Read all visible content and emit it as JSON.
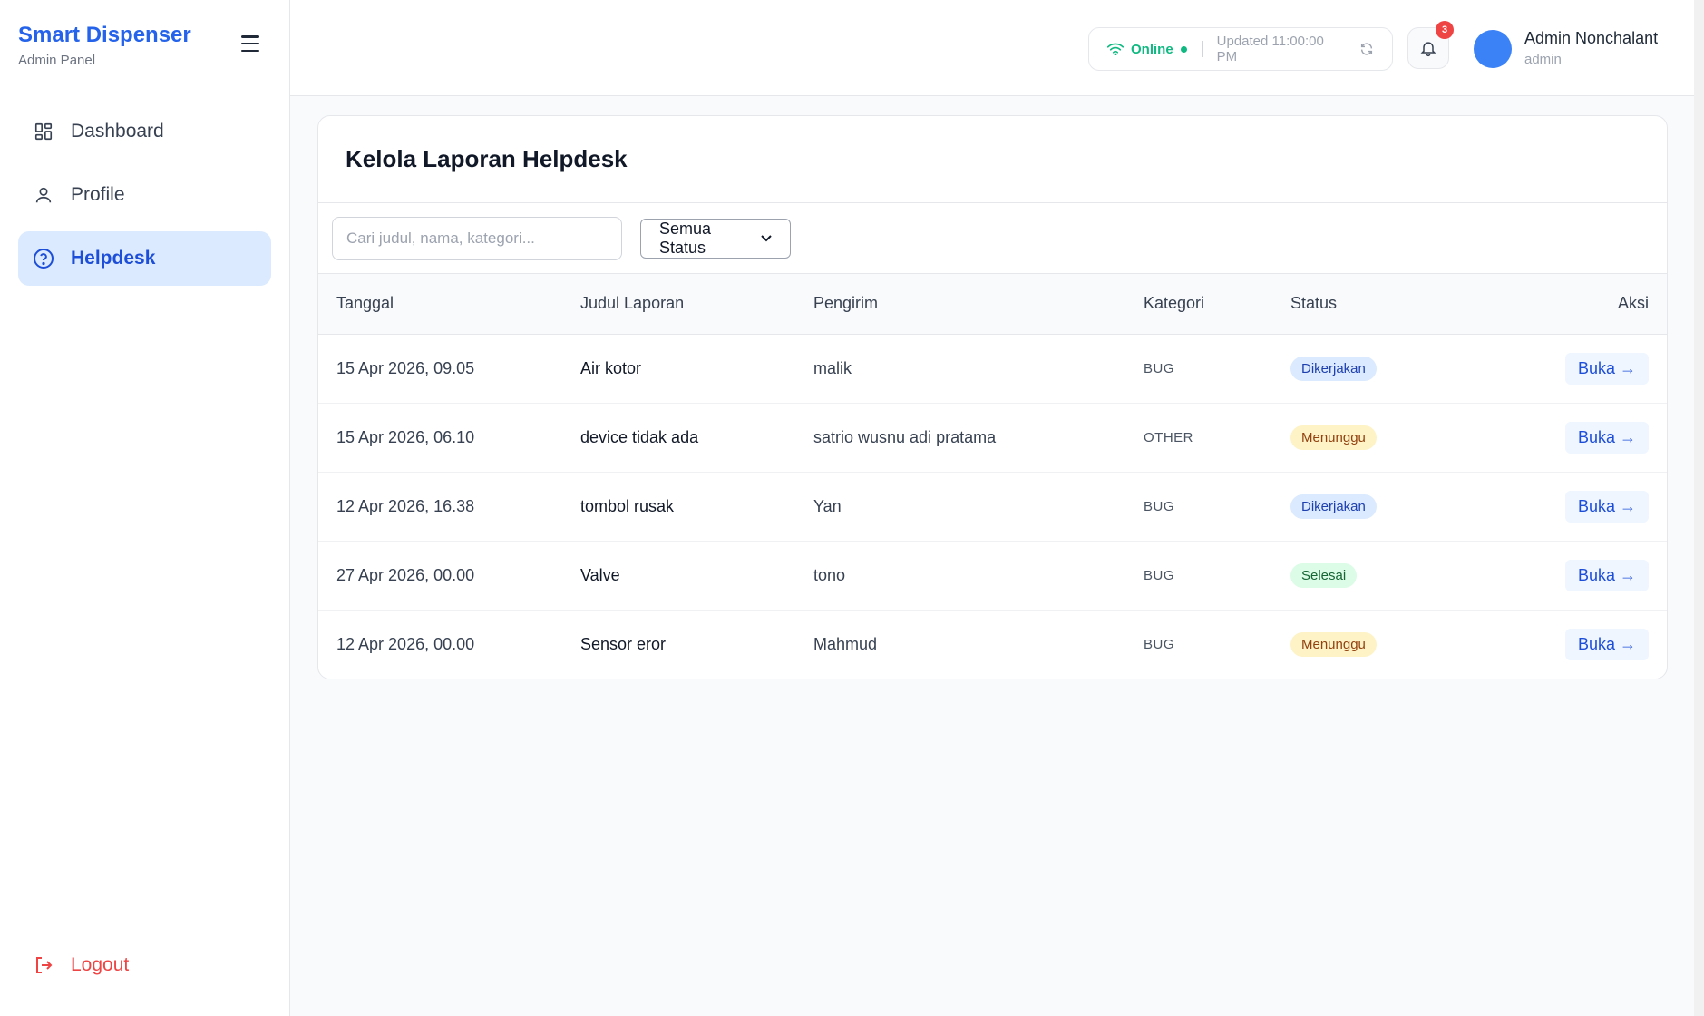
{
  "brand": {
    "title": "Smart Dispenser",
    "subtitle": "Admin Panel"
  },
  "sidebar": {
    "items": [
      {
        "label": "Dashboard",
        "icon": "grid-icon",
        "active": false
      },
      {
        "label": "Profile",
        "icon": "user-icon",
        "active": false
      },
      {
        "label": "Helpdesk",
        "icon": "help-circle-icon",
        "active": true
      }
    ],
    "logout_label": "Logout"
  },
  "header": {
    "online_label": "Online",
    "updated_label": "Updated 11:00:00 PM",
    "notification_count": "3",
    "user_name": "Admin Nonchalant",
    "user_role": "admin"
  },
  "main": {
    "title": "Kelola Laporan Helpdesk",
    "search": {
      "placeholder": "Cari judul, nama, kategori...",
      "value": ""
    },
    "status_filter": {
      "selected": "Semua Status"
    },
    "table": {
      "columns": [
        "Tanggal",
        "Judul Laporan",
        "Pengirim",
        "Kategori",
        "Status",
        "Aksi"
      ],
      "rows": [
        {
          "date": "15 Apr 2026, 09.05",
          "title": "Air kotor",
          "sender": "malik",
          "category": "BUG",
          "status": "Dikerjakan",
          "action": "Buka →"
        },
        {
          "date": "15 Apr 2026, 06.10",
          "title": "device tidak ada",
          "sender": "satrio wusnu adi pratama",
          "category": "OTHER",
          "status": "Menunggu",
          "action": "Buka →"
        },
        {
          "date": "12 Apr 2026, 16.38",
          "title": "tombol rusak",
          "sender": "Yan",
          "category": "BUG",
          "status": "Dikerjakan",
          "action": "Buka →"
        },
        {
          "date": "27 Apr 2026, 00.00",
          "title": "Valve",
          "sender": "tono",
          "category": "BUG",
          "status": "Selesai",
          "action": "Buka →"
        },
        {
          "date": "12 Apr 2026, 00.00",
          "title": "Sensor eror",
          "sender": "Mahmud",
          "category": "BUG",
          "status": "Menunggu",
          "action": "Buka →"
        }
      ]
    }
  },
  "colors": {
    "accent": "#2563eb",
    "online": "#10b981",
    "danger": "#ef4444",
    "status_working_bg": "#dbeafe",
    "status_waiting_bg": "#fef3c7",
    "status_done_bg": "#dcfce7"
  }
}
